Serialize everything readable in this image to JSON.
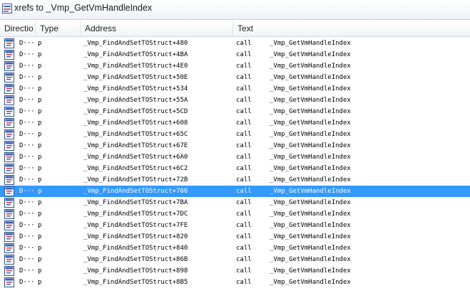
{
  "window": {
    "title": "xrefs to _Vmp_GetVmHandleIndex"
  },
  "columns": [
    "Directio",
    "Type",
    "Address",
    "Text"
  ],
  "selected_row": 13,
  "rows": [
    {
      "direction": "D···",
      "type": "p",
      "address": "_Vmp_FindAndSetTOStruct+480",
      "op": "call",
      "target": "_Vmp_GetVmHandleIndex"
    },
    {
      "direction": "D···",
      "type": "p",
      "address": "_Vmp_FindAndSetTOStruct+4BA",
      "op": "call",
      "target": "_Vmp_GetVmHandleIndex"
    },
    {
      "direction": "D···",
      "type": "p",
      "address": "_Vmp_FindAndSetTOStruct+4E0",
      "op": "call",
      "target": "_Vmp_GetVmHandleIndex"
    },
    {
      "direction": "D···",
      "type": "p",
      "address": "_Vmp_FindAndSetTOStruct+50E",
      "op": "call",
      "target": "_Vmp_GetVmHandleIndex"
    },
    {
      "direction": "D···",
      "type": "p",
      "address": "_Vmp_FindAndSetTOStruct+534",
      "op": "call",
      "target": "_Vmp_GetVmHandleIndex"
    },
    {
      "direction": "D···",
      "type": "p",
      "address": "_Vmp_FindAndSetTOStruct+55A",
      "op": "call",
      "target": "_Vmp_GetVmHandleIndex"
    },
    {
      "direction": "D···",
      "type": "p",
      "address": "_Vmp_FindAndSetTOStruct+5CD",
      "op": "call",
      "target": "_Vmp_GetVmHandleIndex"
    },
    {
      "direction": "D···",
      "type": "p",
      "address": "_Vmp_FindAndSetTOStruct+608",
      "op": "call",
      "target": "_Vmp_GetVmHandleIndex"
    },
    {
      "direction": "D···",
      "type": "p",
      "address": "_Vmp_FindAndSetTOStruct+65C",
      "op": "call",
      "target": "_Vmp_GetVmHandleIndex"
    },
    {
      "direction": "D···",
      "type": "p",
      "address": "_Vmp_FindAndSetTOStruct+67E",
      "op": "call",
      "target": "_Vmp_GetVmHandleIndex"
    },
    {
      "direction": "D···",
      "type": "p",
      "address": "_Vmp_FindAndSetTOStruct+6A0",
      "op": "call",
      "target": "_Vmp_GetVmHandleIndex"
    },
    {
      "direction": "D···",
      "type": "p",
      "address": "_Vmp_FindAndSetTOStruct+6C2",
      "op": "call",
      "target": "_Vmp_GetVmHandleIndex"
    },
    {
      "direction": "D···",
      "type": "p",
      "address": "_Vmp_FindAndSetTOStruct+72B",
      "op": "call",
      "target": "_Vmp_GetVmHandleIndex"
    },
    {
      "direction": "D···",
      "type": "p",
      "address": "_Vmp_FindAndSetTOStruct+766",
      "op": "call",
      "target": "_Vmp_GetVmHandleIndex"
    },
    {
      "direction": "D···",
      "type": "p",
      "address": "_Vmp_FindAndSetTOStruct+7BA",
      "op": "call",
      "target": "_Vmp_GetVmHandleIndex"
    },
    {
      "direction": "D···",
      "type": "p",
      "address": "_Vmp_FindAndSetTOStruct+7DC",
      "op": "call",
      "target": "_Vmp_GetVmHandleIndex"
    },
    {
      "direction": "D···",
      "type": "p",
      "address": "_Vmp_FindAndSetTOStruct+7FE",
      "op": "call",
      "target": "_Vmp_GetVmHandleIndex"
    },
    {
      "direction": "D···",
      "type": "p",
      "address": "_Vmp_FindAndSetTOStruct+820",
      "op": "call",
      "target": "_Vmp_GetVmHandleIndex"
    },
    {
      "direction": "D···",
      "type": "p",
      "address": "_Vmp_FindAndSetTOStruct+840",
      "op": "call",
      "target": "_Vmp_GetVmHandleIndex"
    },
    {
      "direction": "D···",
      "type": "p",
      "address": "_Vmp_FindAndSetTOStruct+86B",
      "op": "call",
      "target": "_Vmp_GetVmHandleIndex"
    },
    {
      "direction": "D···",
      "type": "p",
      "address": "_Vmp_FindAndSetTOStruct+898",
      "op": "call",
      "target": "_Vmp_GetVmHandleIndex"
    },
    {
      "direction": "D···",
      "type": "p",
      "address": "_Vmp_FindAndSetTOStruct+8B5",
      "op": "call",
      "target": "_Vmp_GetVmHandleIndex"
    }
  ],
  "icons": {
    "window": "xref-window-icon",
    "row": "xref-row-icon"
  },
  "colors": {
    "selection": "#3399ff"
  }
}
